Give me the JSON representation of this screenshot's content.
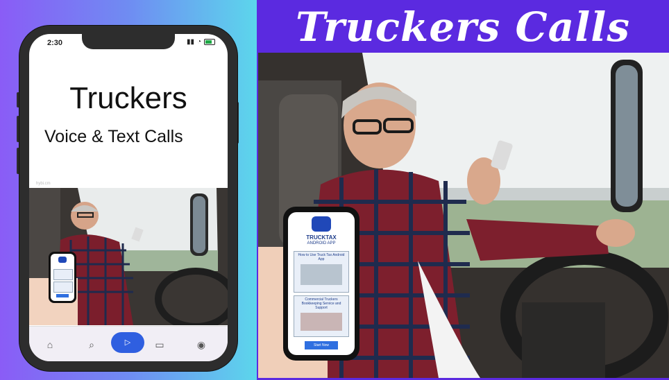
{
  "headline": "Truckers Calls",
  "phone": {
    "status_time": "2:30",
    "app_title": "Truckers",
    "app_subtitle": "Voice & Text Calls",
    "tiny_label": "hybi.cm"
  },
  "handheld_phone": {
    "brand": "TRUCKTAX",
    "brand_sub": "ANDROID APP",
    "card1": "How to Use Truck Tax Android App",
    "card2": "Commercial Truckers Bookkeeping Service and Support",
    "button": "Start Now"
  },
  "nav": {
    "items": [
      "home-icon",
      "search-icon",
      "play-icon",
      "video-icon",
      "account-icon"
    ]
  },
  "colors": {
    "accent": "#5b2ae0",
    "gradient_start": "#8a5cf6",
    "gradient_end": "#5cd6ec",
    "nav_active": "#2f5fe0"
  }
}
